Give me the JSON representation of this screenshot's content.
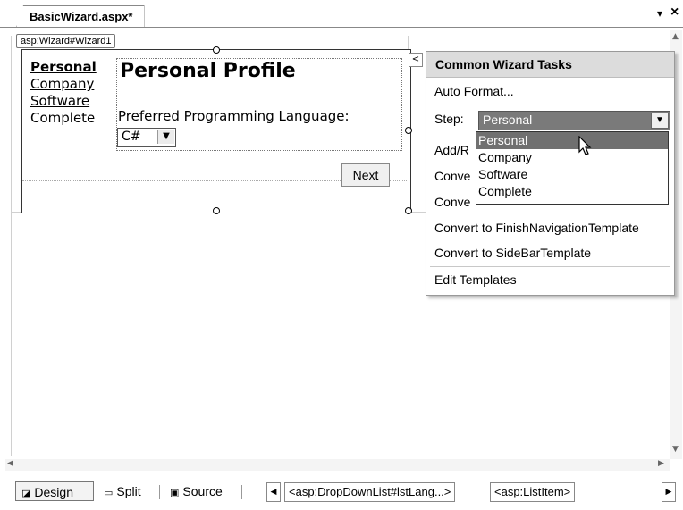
{
  "document_tab": {
    "title": "BasicWizard.aspx*"
  },
  "window_controls": {
    "dropdown_glyph": "▾",
    "close_glyph": "×"
  },
  "wizard_tag": "asp:Wizard#Wizard1",
  "wizard": {
    "sidebar": [
      "Personal",
      "Company",
      "Software",
      "Complete"
    ],
    "step_title": "Personal Profile",
    "language_label": "Preferred Programming Language:",
    "language_value": "C#",
    "next_label": "Next"
  },
  "smart_tag_glyph": "<",
  "tasks_panel": {
    "header": "Common Wizard Tasks",
    "auto_format": "Auto Format...",
    "step_label": "Step:",
    "step_value": "Personal",
    "add_remove_prefix": "Add/R",
    "convert_prefix_1": "Conve",
    "convert_prefix_2": "Conve",
    "convert_finish": "Convert to FinishNavigationTemplate",
    "convert_sidebar": "Convert to SideBarTemplate",
    "edit_templates": "Edit Templates",
    "step_options": [
      "Personal",
      "Company",
      "Software",
      "Complete"
    ]
  },
  "bottom_bar": {
    "design": "Design",
    "split": "Split",
    "source": "Source",
    "crumb_1": "<asp:DropDownList#lstLang...>",
    "crumb_2": "<asp:ListItem>"
  }
}
